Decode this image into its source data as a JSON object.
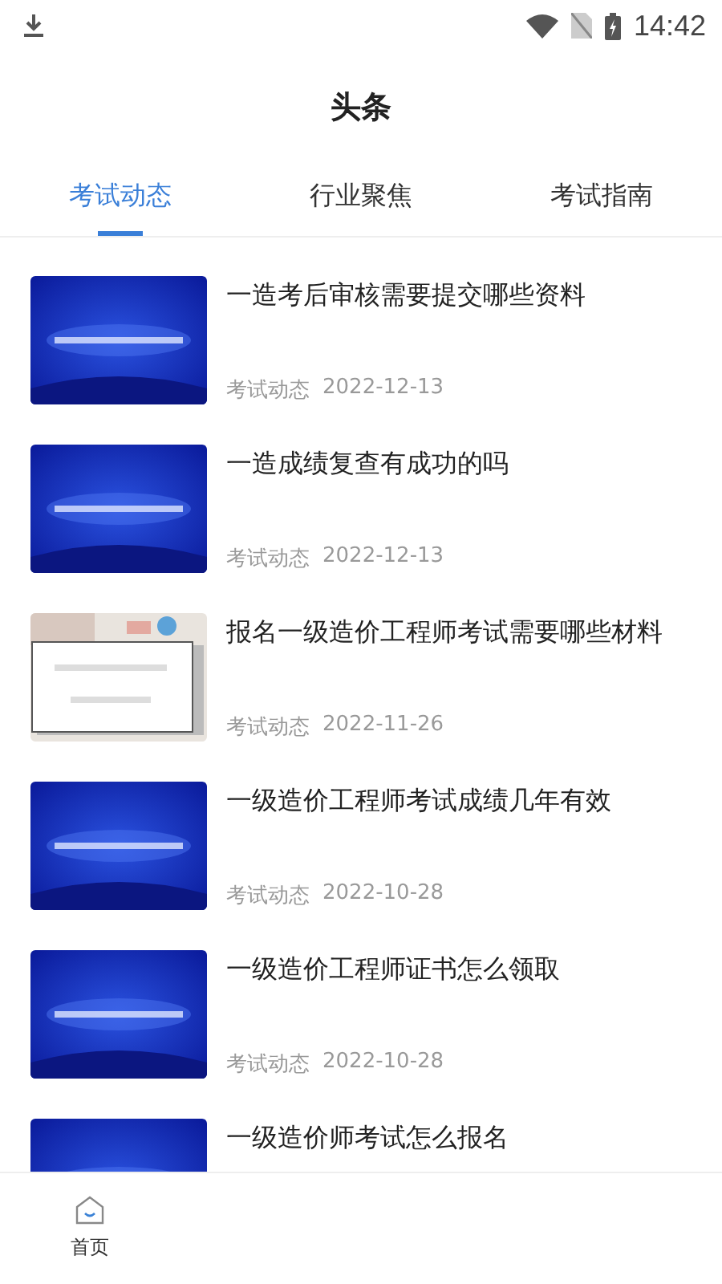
{
  "status_bar": {
    "time": "14:42"
  },
  "header": {
    "title": "头条"
  },
  "tabs": [
    {
      "label": "考试动态",
      "selected": true
    },
    {
      "label": "行业聚焦",
      "selected": false
    },
    {
      "label": "考试指南",
      "selected": false
    }
  ],
  "articles": [
    {
      "thumbnail": {
        "kind": "banner"
      },
      "title": "一造考后审核需要提交哪些资料",
      "category": "考试动态",
      "date": "2022-12-13"
    },
    {
      "thumbnail": {
        "kind": "banner"
      },
      "title": "一造成绩复查有成功的吗",
      "category": "考试动态",
      "date": "2022-12-13"
    },
    {
      "title": "报名一级造价工程师考试需要哪些材料",
      "category": "考试动态",
      "date": "2022-11-26"
    },
    {
      "thumbnail": {
        "kind": "banner"
      },
      "title": "一级造价工程师考试成绩几年有效",
      "category": "考试动态",
      "date": "2022-10-28"
    },
    {
      "thumbnail": {
        "kind": "banner"
      },
      "title": "一级造价工程师证书怎么领取",
      "category": "考试动态",
      "date": "2022-10-28"
    },
    {
      "thumbnail": {
        "kind": "banner"
      },
      "title": "一级造价师考试怎么报名"
    }
  ],
  "bottom_nav": [
    {
      "label": "首页"
    }
  ]
}
